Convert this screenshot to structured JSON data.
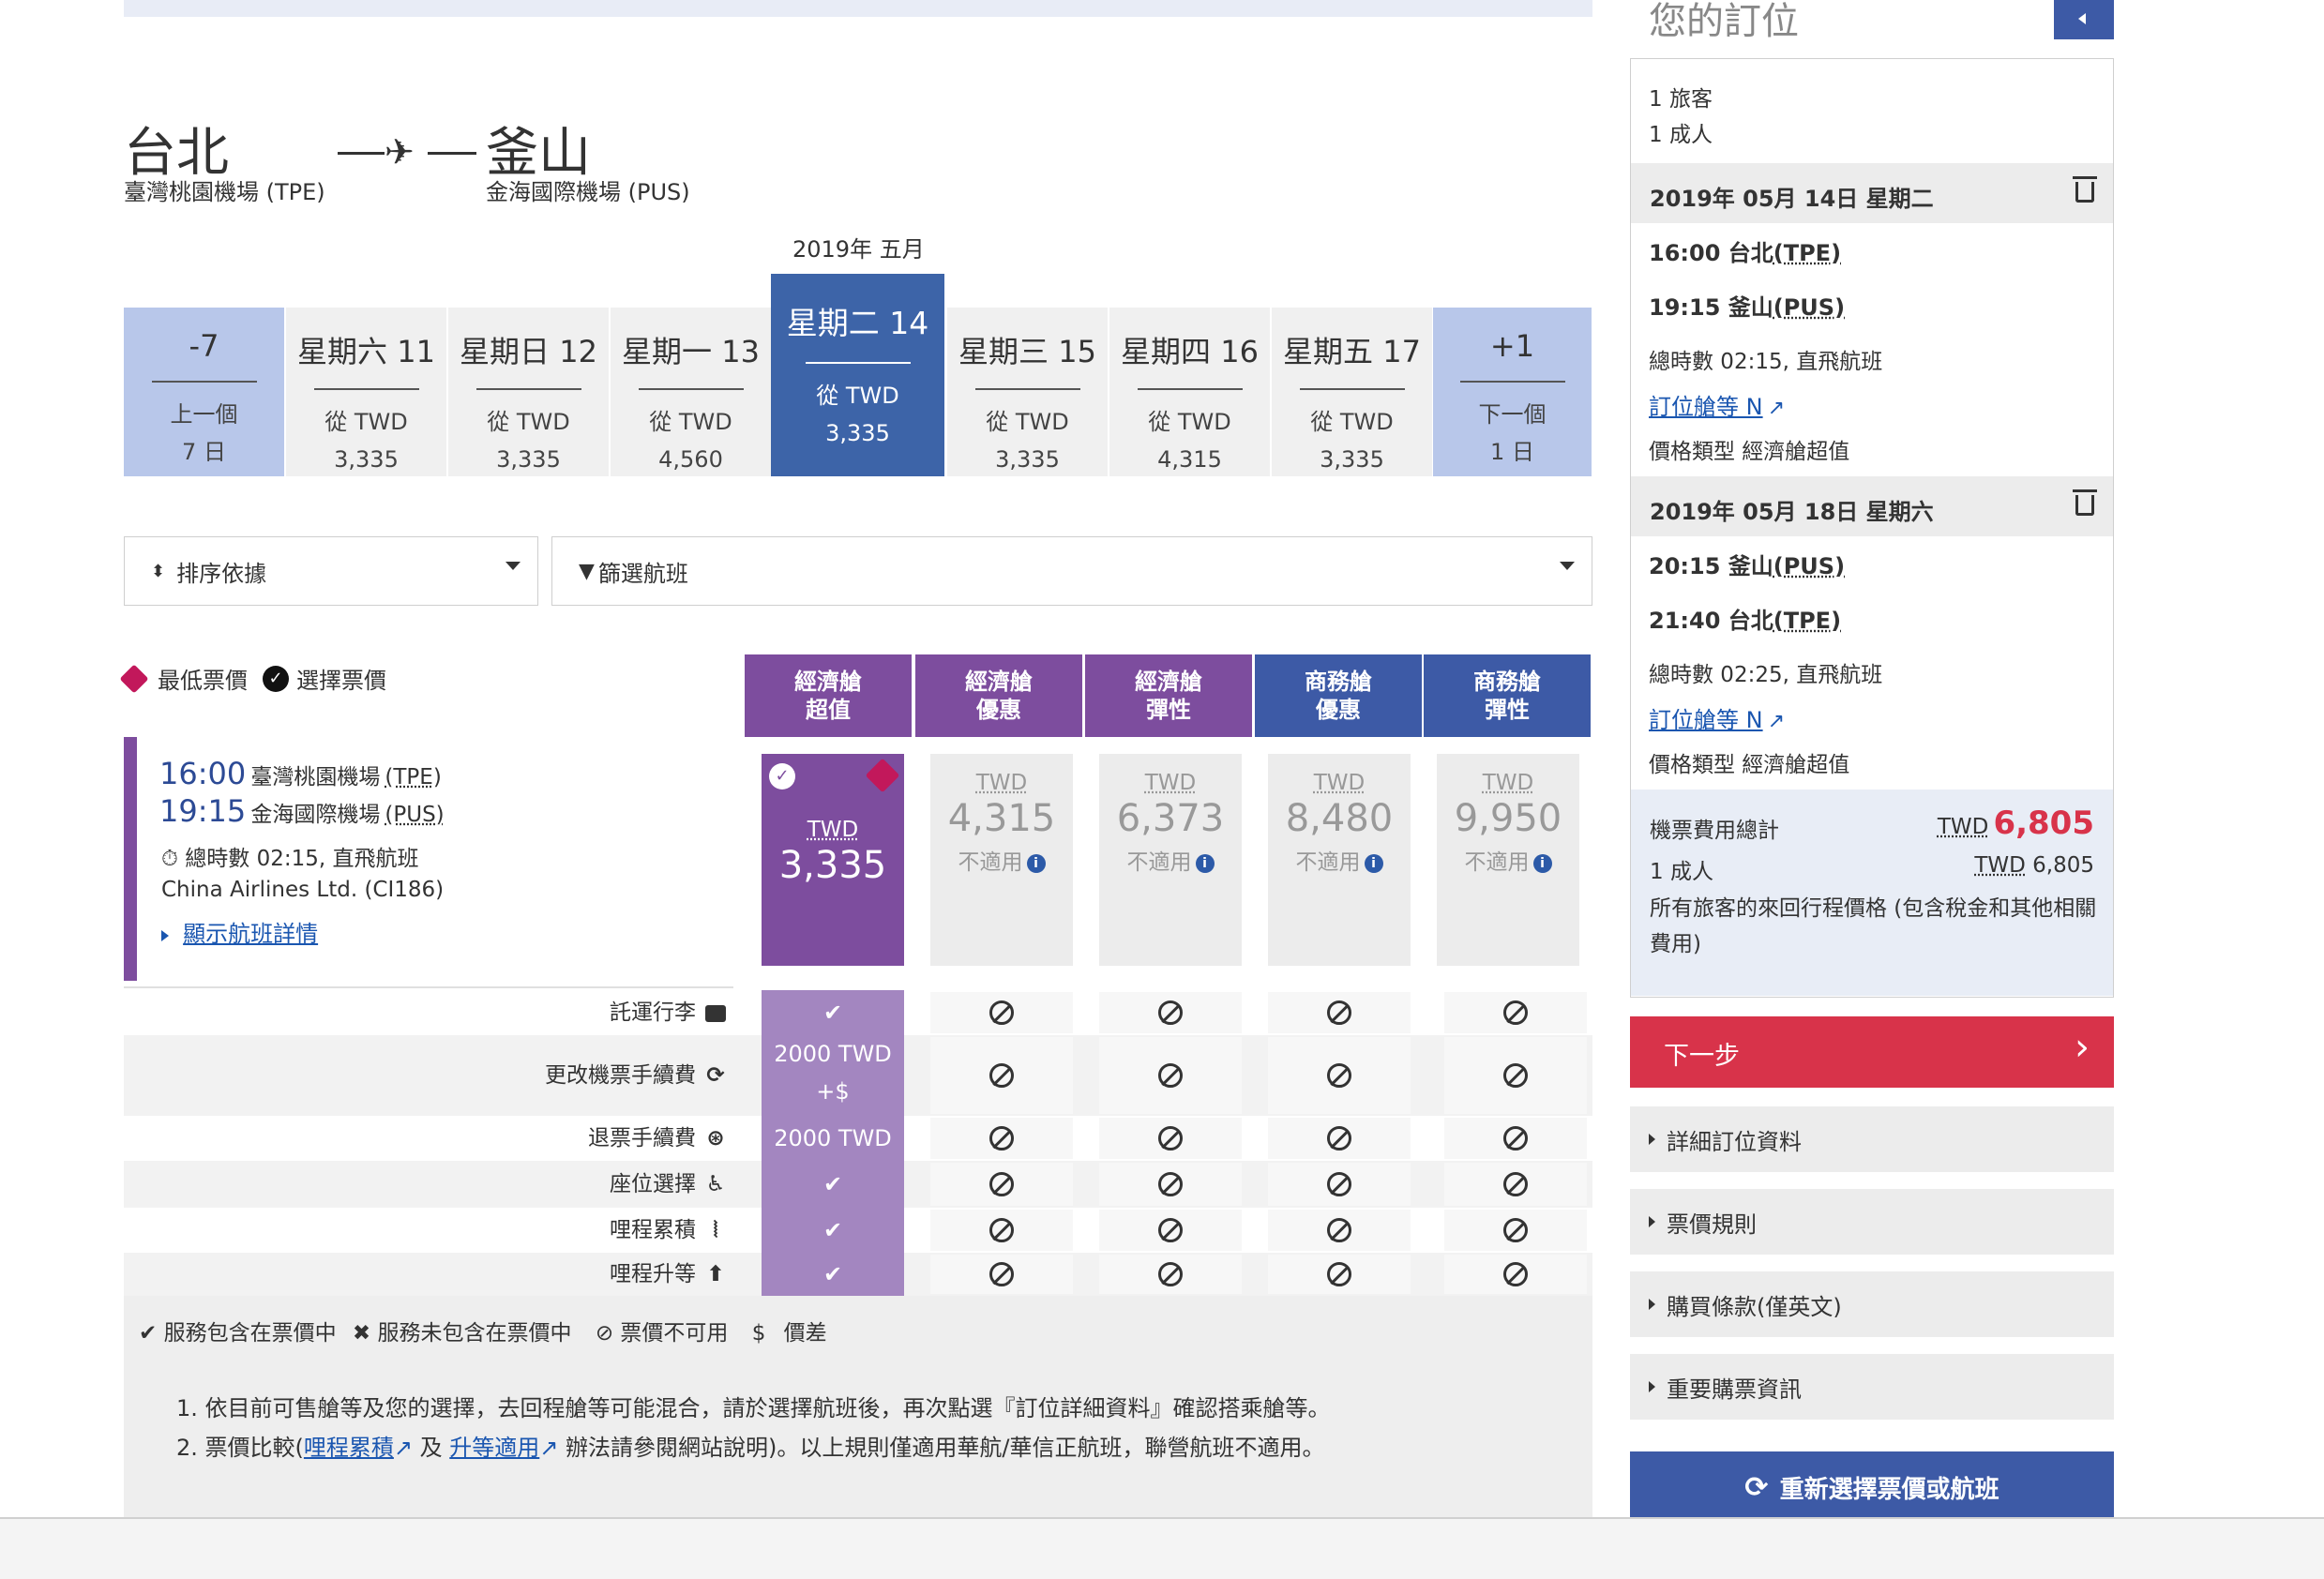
{
  "route": {
    "origin_city": "台北",
    "origin_airport": "臺灣桃園機場 (TPE)",
    "dest_city": "釜山",
    "dest_airport": "金海國際機場 (PUS)",
    "month_label": "2019年 五月"
  },
  "dates": [
    {
      "day": "-7",
      "l1": "上一個",
      "l2": "7 日",
      "nav": true
    },
    {
      "day": "星期六 11",
      "l1": "從 TWD",
      "l2": "3,335"
    },
    {
      "day": "星期日 12",
      "l1": "從 TWD",
      "l2": "3,335"
    },
    {
      "day": "星期一 13",
      "l1": "從 TWD",
      "l2": "4,560"
    },
    {
      "day": "星期二 14",
      "l1": "從 TWD",
      "l2": "3,335",
      "selected": true
    },
    {
      "day": "星期三 15",
      "l1": "從 TWD",
      "l2": "3,335"
    },
    {
      "day": "星期四 16",
      "l1": "從 TWD",
      "l2": "4,315"
    },
    {
      "day": "星期五 17",
      "l1": "從 TWD",
      "l2": "3,335"
    },
    {
      "day": "+1",
      "l1": "下一個",
      "l2": "1 日",
      "nav": true
    }
  ],
  "filters": {
    "sort_label": "排序依據",
    "filter_label": "篩選航班"
  },
  "legend": {
    "lowest": "最低票價",
    "selected": "選擇票價"
  },
  "fare_headers": [
    {
      "l1": "經濟艙",
      "l2": "超值"
    },
    {
      "l1": "經濟艙",
      "l2": "優惠"
    },
    {
      "l1": "經濟艙",
      "l2": "彈性"
    },
    {
      "l1": "商務艙",
      "l2": "優惠"
    },
    {
      "l1": "商務艙",
      "l2": "彈性"
    }
  ],
  "flight": {
    "dep_time": "16:00",
    "dep_airport": "臺灣桃園機場",
    "dep_code": "(TPE)",
    "arr_time": "19:15",
    "arr_airport": "金海國際機場",
    "arr_code": "(PUS)",
    "duration": "總時數 02:15, 直飛航班",
    "carrier": "China Airlines Ltd. (CI186)",
    "details_link": "顯示航班詳情"
  },
  "fares": [
    {
      "currency": "TWD",
      "amount": "3,335",
      "selected": true
    },
    {
      "currency": "TWD",
      "amount": "4,315",
      "na": "不適用"
    },
    {
      "currency": "TWD",
      "amount": "6,373",
      "na": "不適用"
    },
    {
      "currency": "TWD",
      "amount": "8,480",
      "na": "不適用"
    },
    {
      "currency": "TWD",
      "amount": "9,950",
      "na": "不適用"
    }
  ],
  "features": [
    {
      "label": "託運行李",
      "icon": "suitcase-icon",
      "selected": "✔"
    },
    {
      "label": "更改機票手續費",
      "icon": "refresh-icon",
      "selected": "2000 TWD",
      "selected2": "+$"
    },
    {
      "label": "退票手續費",
      "icon": "refund-icon",
      "selected": "2000 TWD"
    },
    {
      "label": "座位選擇",
      "icon": "seat-icon",
      "selected": "✔"
    },
    {
      "label": "哩程累積",
      "icon": "miles-icon",
      "selected": "✔"
    },
    {
      "label": "哩程升等",
      "icon": "upgrade-icon",
      "selected": "✔"
    }
  ],
  "key": {
    "included": "服務包含在票價中",
    "not_included": "服務未包含在票價中",
    "unavailable": "票價不可用",
    "diff_symbol": "$",
    "diff": "價差"
  },
  "notes": {
    "n1": "1. 依目前可售艙等及您的選擇，去回程艙等可能混合，請於選擇航班後，再次點選『訂位詳細資料』確認搭乘艙等。",
    "n2_pre": "2. 票價比較(",
    "n2_link1": "哩程累積",
    "n2_mid": " 及 ",
    "n2_link2": "升等適用",
    "n2_post": " 辦法請參閱網站說明)。以上規則僅適用華航/華信正航班，聯營航班不適用。"
  },
  "sidebar": {
    "title": "您的訂位",
    "travellers": "1 旅客",
    "adults": "1 成人",
    "leg1": {
      "date": "2019年 05月 14日 星期二",
      "dep": "16:00 台北",
      "dep_code": "(TPE)",
      "arr": "19:15 釜山",
      "arr_code": "(PUS)",
      "duration": "總時數 02:15, 直飛航班",
      "class_link": "訂位艙等 N",
      "fare_type": "價格類型 經濟艙超值"
    },
    "leg2": {
      "date": "2019年 05月 18日 星期六",
      "dep": "20:15 釜山",
      "dep_code": "(PUS)",
      "arr": "21:40 台北",
      "arr_code": "(TPE)",
      "duration": "總時數 02:25, 直飛航班",
      "class_link": "訂位艙等 N",
      "fare_type": "價格類型 經濟艙超值"
    },
    "total_label": "機票費用總計",
    "total_currency": "TWD",
    "total_amount": "6,805",
    "per_adult_label": "1 成人",
    "per_adult_currency": "TWD",
    "per_adult_amount": "6,805",
    "total_note": "所有旅客的來回行程價格 (包含稅金和其他相關費用)",
    "next_button": "下一步",
    "sections": [
      "詳細訂位資料",
      "票價規則",
      "購買條款(僅英文)",
      "重要購票資訊"
    ],
    "reselect_button": "重新選擇票價或航班"
  },
  "colors": {
    "economy_purple": "#7d4d9e",
    "business_blue": "#3d5aa6",
    "next_red": "#d8334a",
    "link_blue": "#1a56b0"
  }
}
